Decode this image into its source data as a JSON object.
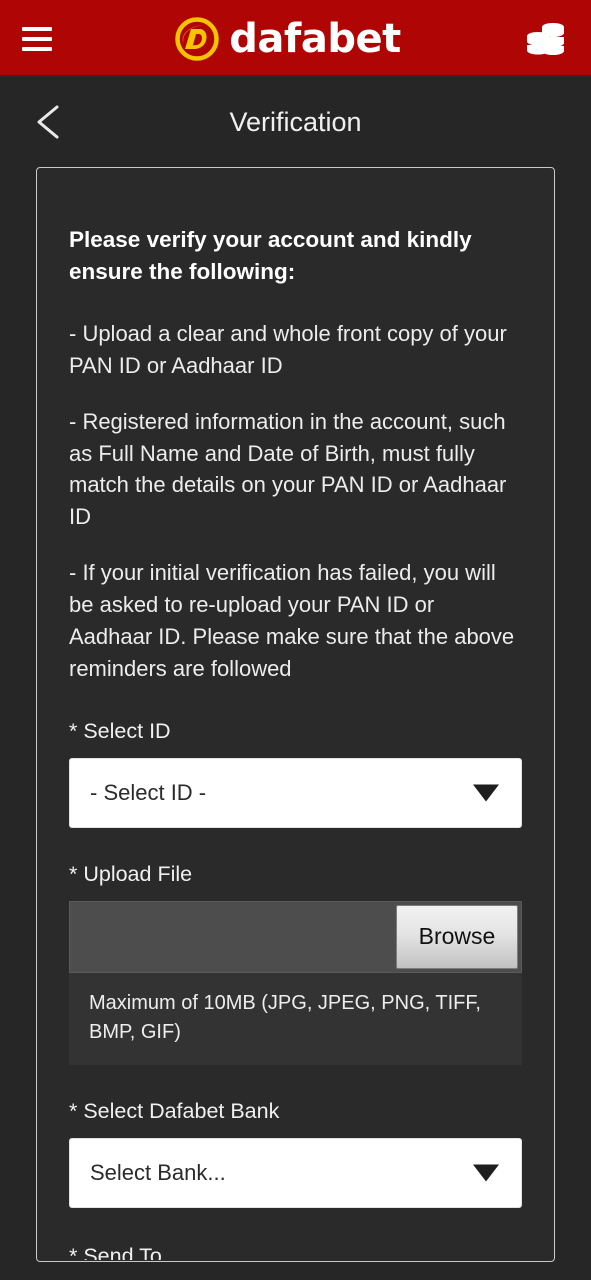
{
  "header": {
    "menu_icon": "hamburger-menu-icon",
    "brand_name": "dafabet",
    "balance_icon": "coin-stack-icon",
    "background_color": "#b00505",
    "logo_gold": "#f5c400"
  },
  "titlebar": {
    "back_icon": "chevron-left-icon",
    "title": "Verification"
  },
  "card": {
    "lead": "Please verify your account and kindly ensure the following:",
    "paragraphs": [
      "- Upload a clear and whole front copy of your PAN ID or Aadhaar ID",
      "- Registered information in the account, such as Full Name and Date of Birth, must fully match the details on your PAN ID or Aadhaar ID",
      "- If your initial verification has failed, you will be asked to re-upload your PAN ID or Aadhaar ID. Please make sure that the above reminders are followed"
    ],
    "select_id": {
      "label": "* Select ID",
      "value": "- Select ID -",
      "arrow_icon": "triangle-down-icon"
    },
    "upload_file": {
      "label": "* Upload File",
      "file_name": "",
      "browse_label": "Browse",
      "hint": "Maximum of 10MB (JPG, JPEG, PNG, TIFF, BMP, GIF)"
    },
    "select_bank": {
      "label": "* Select Dafabet Bank",
      "value": "Select Bank...",
      "arrow_icon": "triangle-down-icon"
    },
    "next_label_partial": "* Send To"
  }
}
